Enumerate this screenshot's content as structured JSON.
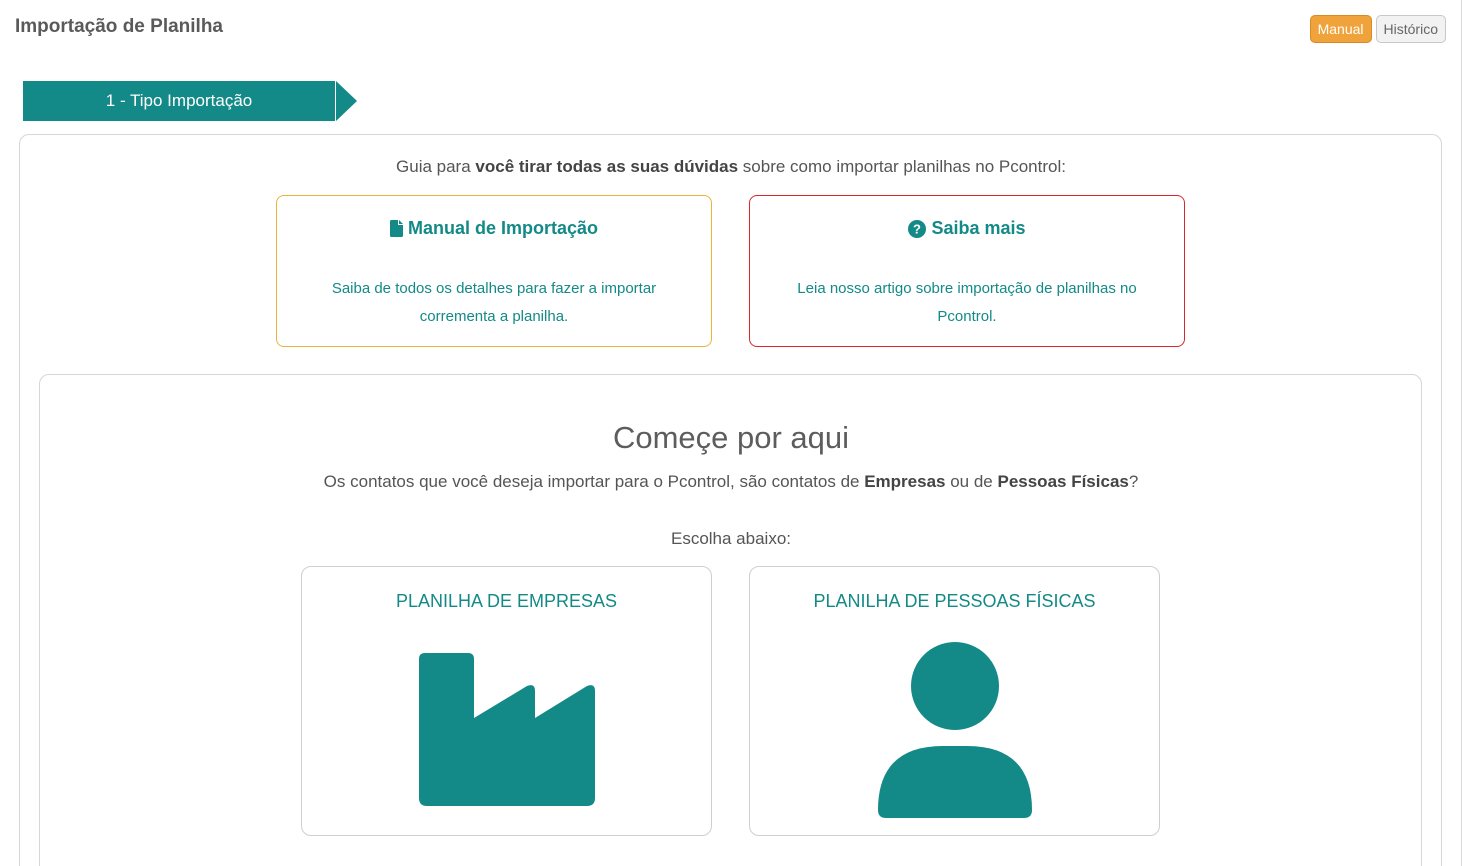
{
  "header": {
    "title": "Importação de Planilha",
    "manual_label": "Manual",
    "history_label": "Histórico"
  },
  "step": {
    "label": "1 - Tipo Importação"
  },
  "guide": {
    "prefix": "Guia para ",
    "bold": "você tirar todas as suas dúvidas",
    "suffix": " sobre como importar planilhas no Pcontrol:"
  },
  "info_cards": {
    "manual": {
      "title": "Manual de Importação",
      "description": "Saiba de todos os detalhes para fazer a importar corrementa a planilha.",
      "icon": "file-icon"
    },
    "saiba": {
      "title": "Saiba mais",
      "description": "Leia nosso artigo sobre importação de planilhas no Pcontrol.",
      "icon": "question-circle-icon"
    }
  },
  "start": {
    "title": "Começe por aqui",
    "question_prefix": "Os contatos que você deseja importar para o Pcontrol, são contatos de ",
    "question_bold1": "Empresas",
    "question_mid": " ou de ",
    "question_bold2": "Pessoas Físicas",
    "question_suffix": "?",
    "choose_label": "Escolha abaixo:"
  },
  "choices": {
    "companies": {
      "label": "PLANILHA DE EMPRESAS",
      "icon": "factory-icon"
    },
    "people": {
      "label": "PLANILHA DE PESSOAS FÍSICAS",
      "icon": "user-icon"
    }
  },
  "colors": {
    "accent": "#138a87",
    "manual_button": "#f0a23b",
    "manual_border": "#e8b43a",
    "saiba_border": "#d9262b"
  }
}
